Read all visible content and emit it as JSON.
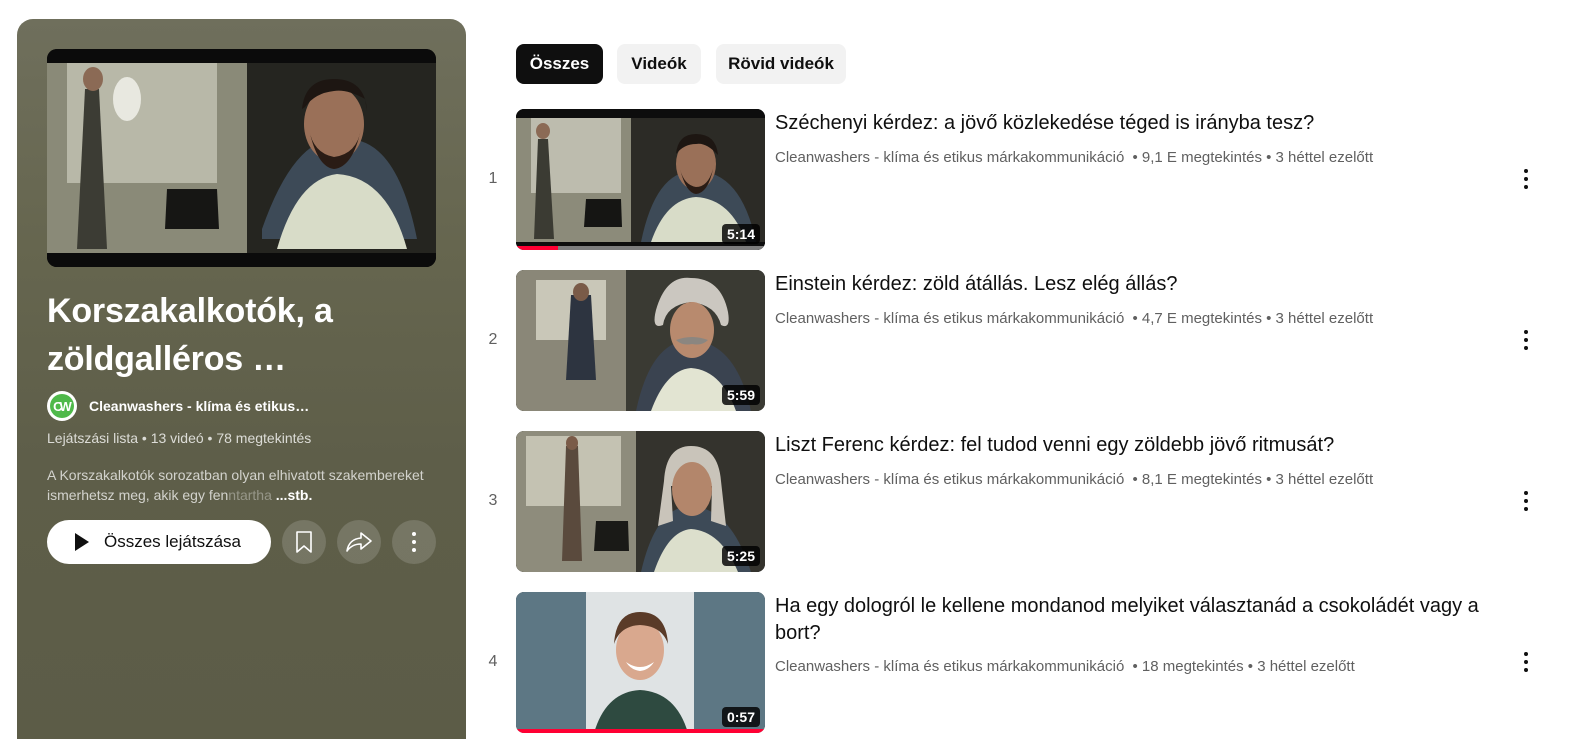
{
  "playlist": {
    "title": "Korszakalkotók, a zöldgalléros …",
    "channel_name": "Cleanwashers - klíma és etikus…",
    "meta": "Lejátszási lista • 13 videó • 78 megtekintés",
    "description": "A Korszakalkotók sorozatban olyan elhivatott szakembereket ismerhetsz meg, akik egy fenntartha",
    "more_label": "...stb.",
    "play_all_label": "Összes lejátszása",
    "avatar_letters": "CW"
  },
  "chips": [
    {
      "label": "Összes",
      "active": true
    },
    {
      "label": "Videók",
      "active": false
    },
    {
      "label": "Rövid videók",
      "active": false
    }
  ],
  "videos": [
    {
      "index": "1",
      "title": "Széchenyi kérdez: a jövő közlekedése téged is irányba tesz?",
      "channel": "Cleanwashers - klíma és etikus márkakommunikáció",
      "stats": "• 9,1 E megtekintés • 3 héttel ezelőtt",
      "duration": "5:14",
      "watched_fraction": 0.17
    },
    {
      "index": "2",
      "title": "Einstein kérdez: zöld átállás. Lesz elég állás?",
      "channel": "Cleanwashers - klíma és etikus márkakommunikáció",
      "stats": "• 4,7 E megtekintés • 3 héttel ezelőtt",
      "duration": "5:59",
      "watched_fraction": 0
    },
    {
      "index": "3",
      "title": "Liszt Ferenc kérdez: fel tudod venni egy zöldebb jövő ritmusát?",
      "channel": "Cleanwashers - klíma és etikus márkakommunikáció",
      "stats": "• 8,1 E megtekintés • 3 héttel ezelőtt",
      "duration": "5:25",
      "watched_fraction": 0
    },
    {
      "index": "4",
      "title": "Ha egy dologról le kellene mondanod melyiket választanád a csokoládét vagy a bort?",
      "channel": "Cleanwashers - klíma és etikus márkakommunikáció",
      "stats": "• 18 megtekintés • 3 héttel ezelőtt",
      "duration": "0:57",
      "watched_fraction": 1.0
    }
  ],
  "colors": {
    "panel_bg": "#5e5e49",
    "accent_red": "#ff0033",
    "chip_active": "#0f0f0f",
    "chip_inactive": "#f2f2f2",
    "channel_avatar": "#4fb94a"
  },
  "icons": {
    "play": "play-icon",
    "save": "bookmark-icon",
    "share": "share-icon",
    "more": "more-vertical-icon"
  }
}
